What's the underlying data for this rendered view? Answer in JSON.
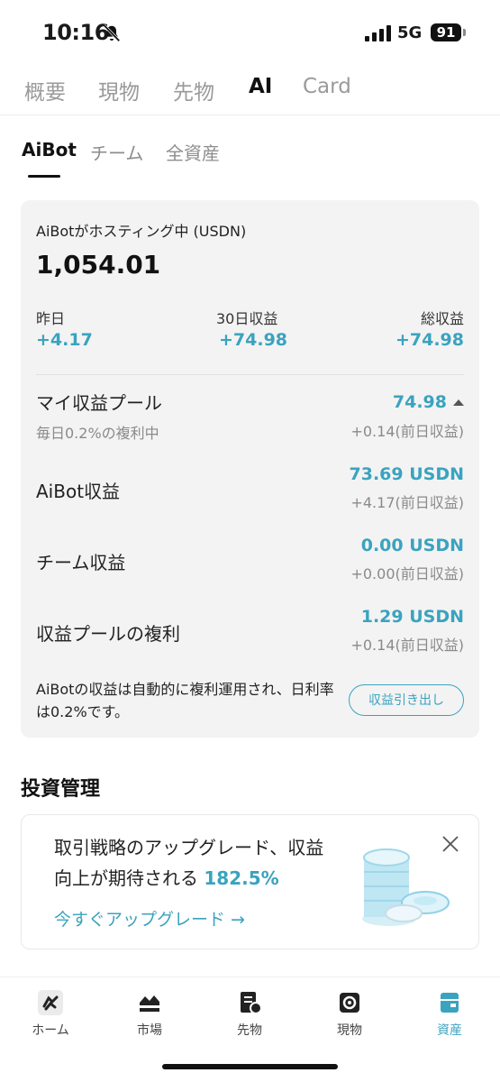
{
  "status_bar": {
    "time": "10:16",
    "network": "5G",
    "battery": "91"
  },
  "top_tabs": [
    "概要",
    "現物",
    "先物",
    "AI",
    "Card"
  ],
  "sub_tabs": [
    "AiBot",
    "チーム",
    "全資産"
  ],
  "summary": {
    "label": "AiBotがホスティング中 (USDN)",
    "total": "1,054.01",
    "stats": [
      {
        "label": "昨日",
        "value": "+4.17"
      },
      {
        "label": "30日収益",
        "value": "+74.98"
      },
      {
        "label": "総収益",
        "value": "+74.98"
      }
    ]
  },
  "pool": {
    "title": "マイ収益プール",
    "subtitle": "毎日0.2%の複利中",
    "value": "74.98",
    "prev": "+0.14(前日収益)"
  },
  "rows": [
    {
      "title": "AiBot収益",
      "value": "73.69 USDN",
      "prev": "+4.17(前日収益)"
    },
    {
      "title": "チーム収益",
      "value": "0.00 USDN",
      "prev": "+0.00(前日収益)"
    },
    {
      "title": "収益プールの複利",
      "value": "1.29 USDN",
      "prev": "+0.14(前日収益)"
    }
  ],
  "note": "AiBotの収益は自動的に複利運用され、日利率は0.2%です。",
  "withdraw_label": "収益引き出し",
  "investment": {
    "title": "投資管理",
    "promo_text": "取引戦略のアップグレード、収益向上が期待される",
    "promo_rate": "182.5%",
    "promo_link": "今すぐアップグレード →"
  },
  "bottom_nav": [
    {
      "label": "ホーム",
      "icon": "home-logo-icon"
    },
    {
      "label": "市場",
      "icon": "market-icon"
    },
    {
      "label": "先物",
      "icon": "futures-icon"
    },
    {
      "label": "現物",
      "icon": "spot-icon"
    },
    {
      "label": "資産",
      "icon": "assets-icon"
    }
  ],
  "colors": {
    "accent": "#3aa3bf",
    "card_bg": "#f3f3f3"
  }
}
